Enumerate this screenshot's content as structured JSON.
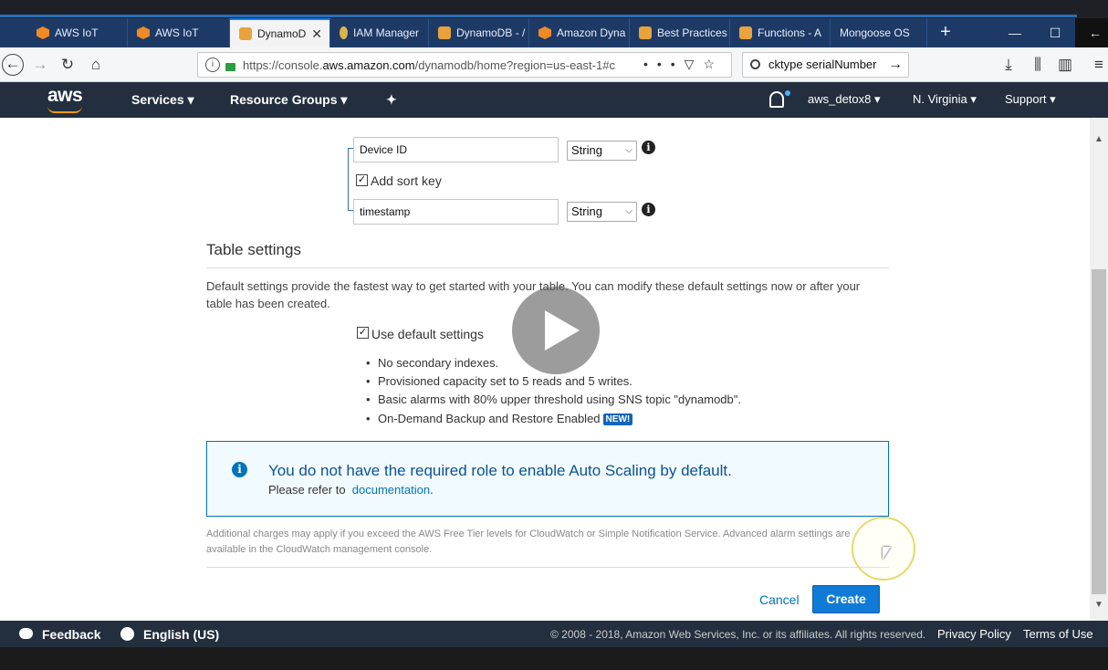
{
  "browser": {
    "tabs": [
      {
        "label": "AWS IoT",
        "icon": "aws-iot-icon"
      },
      {
        "label": "AWS IoT",
        "icon": "aws-iot-icon"
      },
      {
        "label": "DynamoDB",
        "icon": "dynamodb-icon",
        "active": true
      },
      {
        "label": "IAM Manager",
        "icon": "iam-key-icon"
      },
      {
        "label": "DynamoDB - /",
        "icon": "dynamodb-icon"
      },
      {
        "label": "Amazon Dyna",
        "icon": "aws-icon"
      },
      {
        "label": "Best Practices",
        "icon": "box-icon"
      },
      {
        "label": "Functions - A",
        "icon": "box-icon"
      },
      {
        "label": "Mongoose OS",
        "icon": ""
      }
    ],
    "url_prefix": "https://console.",
    "url_domain": "aws.amazon.com",
    "url_suffix": "/dynamodb/home?region=us-east-1#c",
    "search_text": "cktype  serialNumber"
  },
  "aws_header": {
    "logo": "aws",
    "services": "Services ▾",
    "resource_groups": "Resource Groups ▾",
    "user": "aws_detox8 ▾",
    "region": "N. Virginia ▾",
    "support": "Support ▾"
  },
  "key_schema": {
    "partition_key": "Device ID",
    "partition_type": "String",
    "add_sort_key_label": "Add sort key",
    "add_sort_key_checked": true,
    "sort_key": "timestamp",
    "sort_type": "String"
  },
  "table_settings": {
    "heading": "Table settings",
    "description": "Default settings provide the fastest way to get started with your table. You can modify these default settings now or after your table has been created.",
    "use_default_label": "Use default settings",
    "use_default_checked": true,
    "bullets": [
      "No secondary indexes.",
      "Provisioned capacity set to 5 reads and 5 writes.",
      "Basic alarms with 80% upper threshold using SNS topic \"dynamodb\".",
      "On-Demand Backup and Restore Enabled"
    ],
    "new_badge": "NEW!"
  },
  "alert": {
    "title": "You do not have the required role to enable Auto Scaling by default.",
    "sub_prefix": "Please refer to",
    "link": "documentation",
    "sub_suffix": "."
  },
  "fine_print": "Additional charges may apply if you exceed the AWS Free Tier levels for CloudWatch or Simple Notification Service. Advanced alarm settings are available in the CloudWatch management console.",
  "actions": {
    "cancel": "Cancel",
    "create": "Create"
  },
  "footer": {
    "feedback": "Feedback",
    "language": "English (US)",
    "copyright": "© 2008 - 2018, Amazon Web Services, Inc. or its affiliates. All rights reserved.",
    "privacy": "Privacy Policy",
    "terms": "Terms of Use"
  },
  "colors": {
    "aws_nav": "#232f3e",
    "primary_button": "#0f7bd6",
    "link": "#0073bb",
    "browser_tabbar": "#1d3a66"
  }
}
